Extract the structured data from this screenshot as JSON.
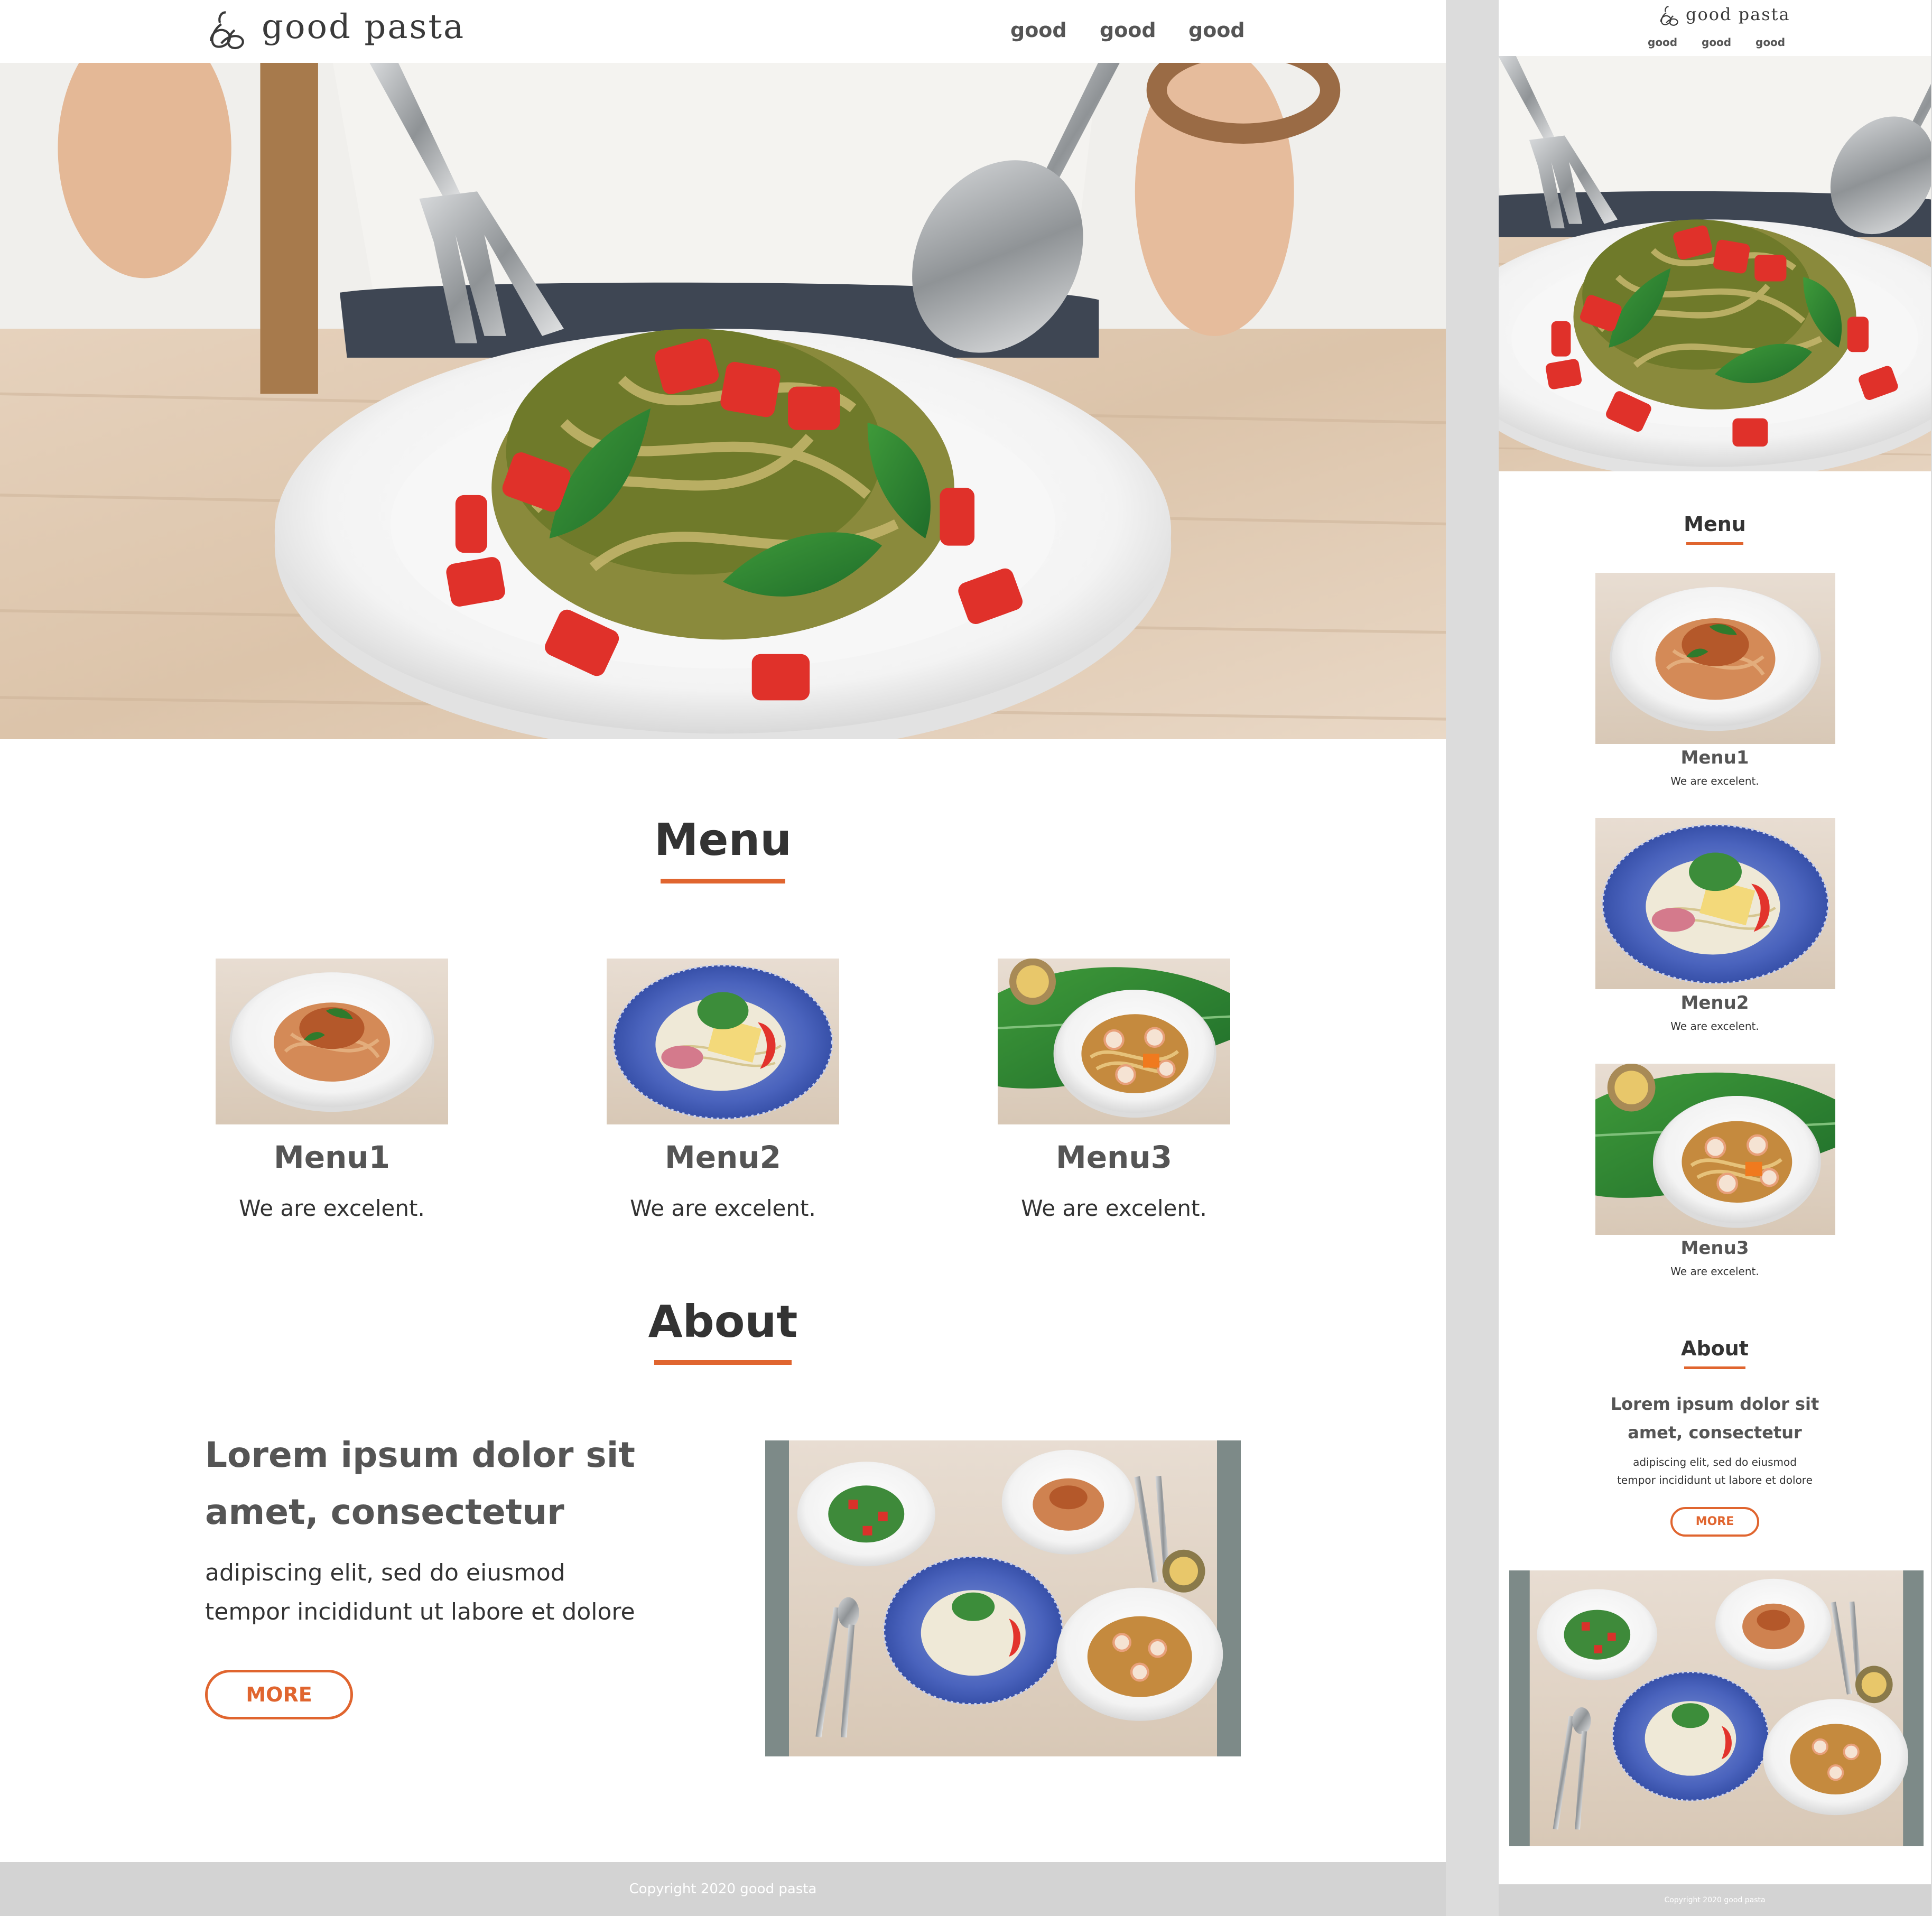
{
  "brand": {
    "name": "good pasta",
    "logo_icon": "pasta-swirl-icon"
  },
  "nav": [
    "good",
    "good",
    "good"
  ],
  "hero": {
    "image": "pesto-pasta-hero-photo"
  },
  "menu": {
    "title": "Menu",
    "items": [
      {
        "name": "Menu1",
        "desc": "We are excelent.",
        "image": "bolognese-pasta-photo"
      },
      {
        "name": "Menu2",
        "desc": "We are excelent.",
        "image": "cold-noodle-blue-plate-photo"
      },
      {
        "name": "Menu3",
        "desc": "We are excelent.",
        "image": "shrimp-pasta-leaf-photo"
      }
    ]
  },
  "about": {
    "title": "About",
    "heading": "Lorem ipsum dolor sit amet, consectetur",
    "heading_line1": "Lorem ipsum dolor sit",
    "heading_line2": "amet, consectetur",
    "body_line1": "adipiscing elit, sed do eiusmod",
    "body_line2": "tempor incididunt ut labore et dolore",
    "button": "MORE",
    "image": "four-pasta-dishes-table-photo"
  },
  "footer": {
    "copyright": "Copyright 2020 good pasta"
  },
  "colors": {
    "accent": "#e0652f",
    "footer_bg": "#d3d3d3",
    "page_bg": "#dcdcdc",
    "text": "#333333"
  }
}
